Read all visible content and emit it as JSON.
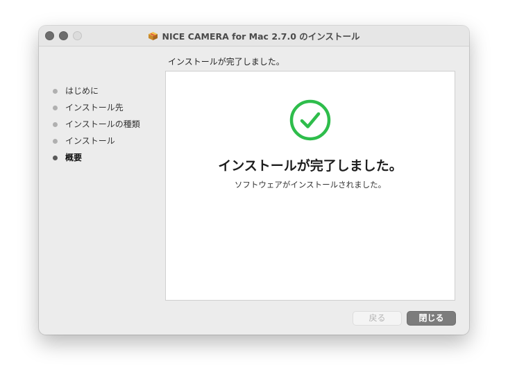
{
  "window": {
    "title": "NICE CAMERA for Mac 2.7.0 のインストール",
    "title_icon": "package-icon"
  },
  "header": {
    "status_text": "インストールが完了しました。"
  },
  "sidebar": {
    "steps": [
      {
        "label": "はじめに",
        "current": false
      },
      {
        "label": "インストール先",
        "current": false
      },
      {
        "label": "インストールの種類",
        "current": false
      },
      {
        "label": "インストール",
        "current": false
      },
      {
        "label": "概要",
        "current": true
      }
    ]
  },
  "main": {
    "icon": "checkmark-circle-icon",
    "icon_color": "#2ebd4b",
    "heading": "インストールが完了しました。",
    "message": "ソフトウェアがインストールされました。"
  },
  "footer": {
    "back_label": "戻る",
    "close_label": "閉じる"
  }
}
